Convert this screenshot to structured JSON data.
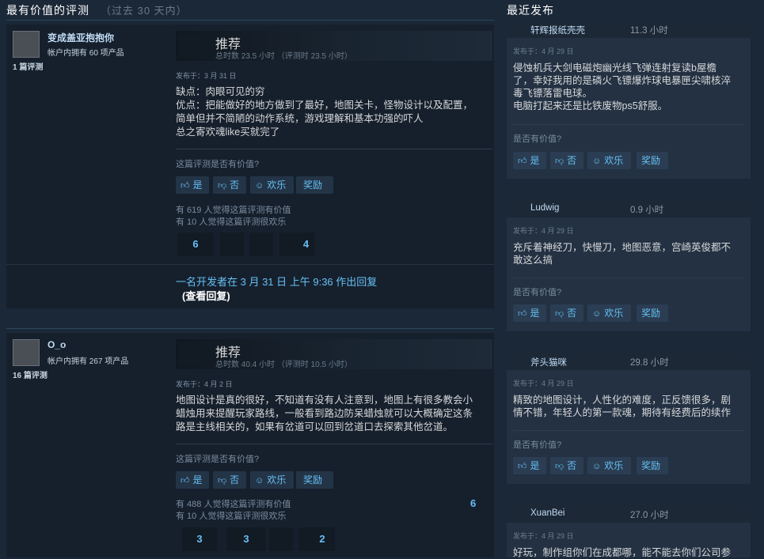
{
  "left": {
    "title": "最有价值的评测",
    "subtitle": "（过去 30 天内）",
    "reviews": [
      {
        "name": "变成盖亚抱抱你",
        "owned": "帐户内拥有 60 项产品",
        "count": "1 篇评测",
        "vote": "推荐",
        "hours": "总时数 23.5 小时 （评测时 23.5 小时）",
        "posted": "发布于：3 月 31 日",
        "body": [
          "缺点：肉眼可见的穷",
          "优点：把能做好的地方做到了最好，地图关卡，怪物设计以及配置，",
          "简单但并不简陋的动作系统，游戏理解和基本功强的吓人",
          "总之寄欢魂like买就完了"
        ],
        "help_question": "这篇评测是否有价值?",
        "yes": "是",
        "no": "否",
        "funny": "欢乐",
        "award": "奖励",
        "stat1": "有 619 人觉得这篇评测有价值",
        "stat2": "有 10 人觉得这篇评测很欢乐",
        "awards": [
          "6",
          "",
          "",
          "4"
        ],
        "dev_reply": "一名开发者在 3 月 31 日 上午 9:36 作出回复",
        "dev_view": "(查看回复)"
      },
      {
        "name": "O_o",
        "owned": "帐户内拥有 267 项产品",
        "count": "16 篇评测",
        "vote": "推荐",
        "hours": "总时数 40.4 小时 （评测时 10.5 小时）",
        "posted": "发布于：4 月 2 日",
        "body": [
          "地图设计是真的很好，不知道有没有人注意到，地图上有很多教会小",
          "蜡烛用来提醒玩家路线，一般看到路边防呆蜡烛就可以大概确定这条",
          "路是主线相关的，如果有岔道可以回到岔道口去探索其他岔道。"
        ],
        "help_question": "这篇评测是否有价值?",
        "yes": "是",
        "no": "否",
        "funny": "欢乐",
        "award": "奖励",
        "stat1": "有 488 人觉得这篇评测有价值",
        "stat2": "有 10 人觉得这篇评测很欢乐",
        "side_count": "6",
        "awards": [
          "3",
          "3",
          "",
          "2"
        ]
      }
    ]
  },
  "right": {
    "title": "最近发布",
    "cards": [
      {
        "name": "轩辉报纸壳壳",
        "hours": "11.3 小时",
        "posted": "发布于：4 月 29 日",
        "body": [
          "侵蚀机兵大剑电磁炮幽光线飞弹连射复读b屋檐",
          "了，幸好我用的是磷火飞镖爆炸球电暴匣尖啸核淬",
          "毒飞镖落雷电球。",
          "电脑打起来还是比铁废物ps5舒服。"
        ],
        "help_question": "是否有价值?",
        "yes": "是",
        "no": "否",
        "funny": "欢乐",
        "award": "奖励"
      },
      {
        "name": "Ludwig",
        "hours": "0.9 小时",
        "posted": "发布于：4 月 29 日",
        "body": [
          "充斥着神经刀，快慢刀，地图恶意，宫崎英俊都不",
          "敢这么搞"
        ],
        "help_question": "是否有价值?",
        "yes": "是",
        "no": "否",
        "funny": "欢乐",
        "award": "奖励"
      },
      {
        "name": "斧头猫咪",
        "hours": "29.8 小时",
        "posted": "发布于：4 月 29 日",
        "body": [
          "精致的地图设计，人性化的难度，正反馈很多，剧",
          "情不错，年轻人的第一款魂，期待有经费后的续作"
        ],
        "help_question": "是否有价值?",
        "yes": "是",
        "no": "否",
        "funny": "欢乐",
        "award": "奖励"
      },
      {
        "name": "XuanBei",
        "hours": "27.0 小时",
        "posted": "发布于：4 月 29 日",
        "body": [
          "好玩，制作组你们在成都哪，能不能去你们公司参"
        ]
      }
    ]
  },
  "icons": {
    "thumbs_up": "thumbs-up-icon",
    "thumbs_down": "thumbs-down-icon",
    "funny": "smiley-icon"
  },
  "colors": {
    "background": "#1b2838",
    "link": "#66c0f4",
    "card": "#233143"
  }
}
